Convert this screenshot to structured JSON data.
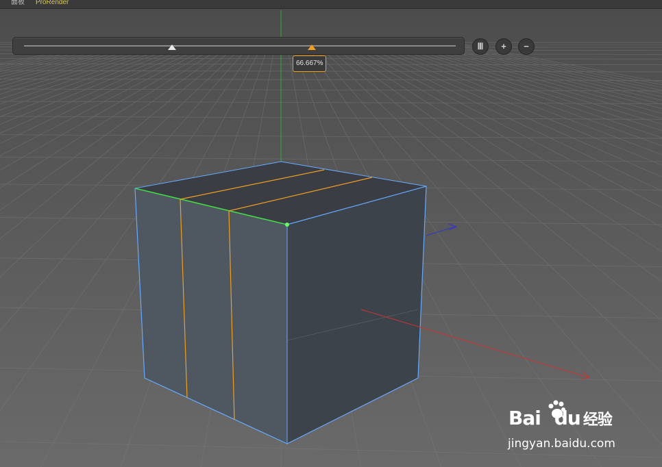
{
  "menubar": {
    "items": [
      "面板",
      "ProRender"
    ]
  },
  "slider": {
    "value_label": "66.667%",
    "handle_value": 0.66667,
    "buttons": [
      {
        "name": "columns-icon",
        "glyph": "Ⅲ"
      },
      {
        "name": "plus-icon",
        "glyph": "+"
      },
      {
        "name": "minus-icon",
        "glyph": "−"
      }
    ]
  },
  "watermark": {
    "brand": "Bai",
    "brand_suffix": "du",
    "chinese": "经验",
    "url": "jingyan.baidu.com"
  },
  "colors": {
    "accent": "#f0a020",
    "selection_edge": "#44dd44",
    "x_axis": "#cc3333",
    "y_axis": "#33aa33",
    "z_axis": "#3333cc",
    "cube_outline": "#66aaff"
  }
}
